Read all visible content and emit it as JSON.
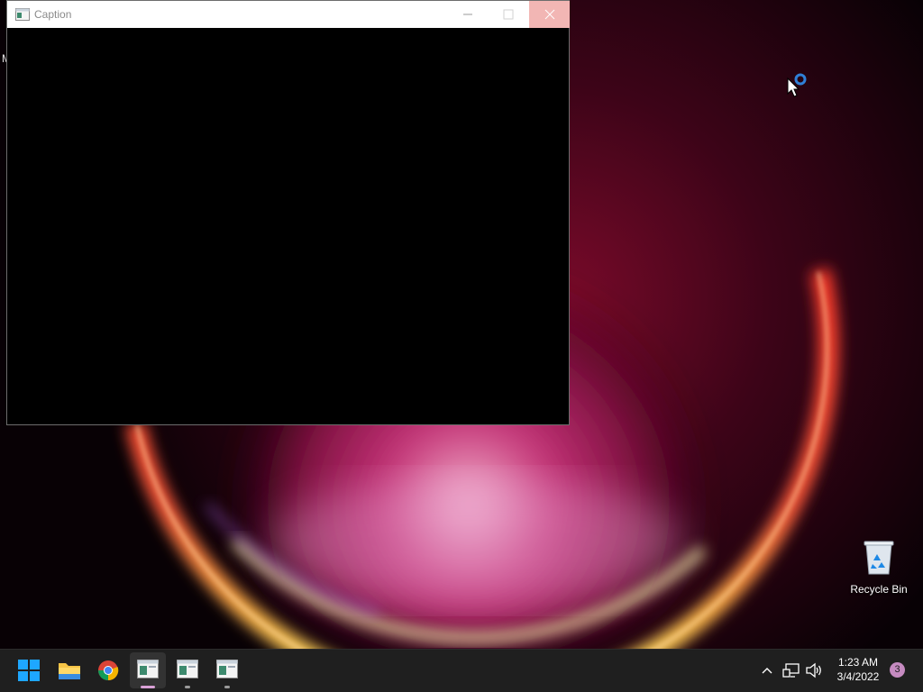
{
  "window": {
    "title": "Caption",
    "buttons": [
      "minimize",
      "maximize",
      "close"
    ]
  },
  "desktop": {
    "edge_text": "M",
    "icons": [
      {
        "label": "Recycle Bin",
        "icon": "recycle-bin-icon"
      }
    ]
  },
  "taskbar": {
    "items": [
      {
        "name": "start",
        "icon": "windows-start-icon"
      },
      {
        "name": "file-explorer",
        "icon": "folder-icon"
      },
      {
        "name": "chrome",
        "icon": "chrome-icon"
      },
      {
        "name": "app-window-1",
        "icon": "app-window-icon",
        "active": true
      },
      {
        "name": "app-window-2",
        "icon": "app-window-icon",
        "active": false
      },
      {
        "name": "app-window-3",
        "icon": "app-window-icon",
        "active": false
      }
    ],
    "tray": {
      "icons": [
        "chevron-up-icon",
        "network-icon",
        "volume-icon"
      ],
      "time": "1:23 AM",
      "date": "3/4/2022",
      "notification_count": "3"
    }
  },
  "colors": {
    "taskbar_bg": "#1f1f1f",
    "close_hover": "#f2b6b4",
    "accent_indicator": "#d9a0d6",
    "badge": "#c58ac0"
  }
}
